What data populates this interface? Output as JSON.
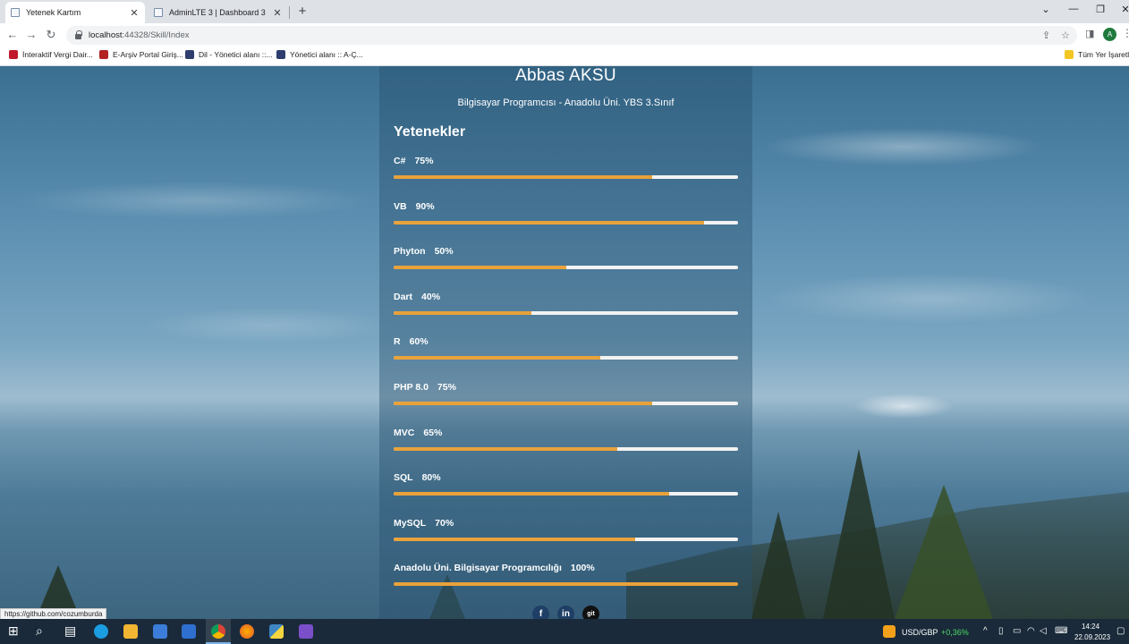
{
  "browser": {
    "tabs": [
      {
        "title": "Yetenek Kartım",
        "active": true
      },
      {
        "title": "AdminLTE 3 | Dashboard 3",
        "active": false
      }
    ],
    "url_host": "localhost",
    "url_rest": ":44328/Skill/Index",
    "profile_initial": "A",
    "bookmarks": [
      {
        "label": "İnteraktif Vergi Dair...",
        "icon_color": "#c0182c"
      },
      {
        "label": "E-Arşiv Portal Giriş...",
        "icon_color": "#b22222"
      },
      {
        "label": "Dil - Yönetici alanı ::...",
        "icon_color": "#2f3e6e"
      },
      {
        "label": "Yönetici alanı :: A-Ç...",
        "icon_color": "#2f3e6e"
      },
      {
        "label": "Tüm Yer İşaretle",
        "icon_color": "#f3c623"
      }
    ]
  },
  "profile": {
    "name": "Abbas AKSU",
    "subtitle": "Bilgisayar Programcısı - Anadolu Üni. YBS 3.Sınıf"
  },
  "skills_title": "Yetenekler",
  "skills": [
    {
      "name": "C#",
      "percent_label": "75%",
      "percent": 75
    },
    {
      "name": "VB",
      "percent_label": "90%",
      "percent": 90
    },
    {
      "name": "Phyton",
      "percent_label": "50%",
      "percent": 50
    },
    {
      "name": "Dart",
      "percent_label": "40%",
      "percent": 40
    },
    {
      "name": "R",
      "percent_label": "60%",
      "percent": 60
    },
    {
      "name": "PHP 8.0",
      "percent_label": "75%",
      "percent": 75
    },
    {
      "name": "MVC",
      "percent_label": "65%",
      "percent": 65
    },
    {
      "name": "SQL",
      "percent_label": "80%",
      "percent": 80
    },
    {
      "name": "MySQL",
      "percent_label": "70%",
      "percent": 70
    },
    {
      "name": "Anadolu Üni. Bilgisayar Programcılığı",
      "percent_label": "100%",
      "percent": 100
    }
  ],
  "socials": [
    {
      "name": "facebook-icon",
      "glyph": "f"
    },
    {
      "name": "linkedin-icon",
      "glyph": "in"
    },
    {
      "name": "github-icon",
      "glyph": "git"
    }
  ],
  "status_url": "https://github.com/cozumburda",
  "colors": {
    "bar_fill": "#e9a23b",
    "bar_track": "#f2f2f2",
    "card_overlay": "rgba(40, 80, 110, 0.42)"
  },
  "taskbar": {
    "ticker": "USD/GBP",
    "ticker_change": "+0,36%",
    "time": "14:24",
    "date": "22.09.2023"
  }
}
